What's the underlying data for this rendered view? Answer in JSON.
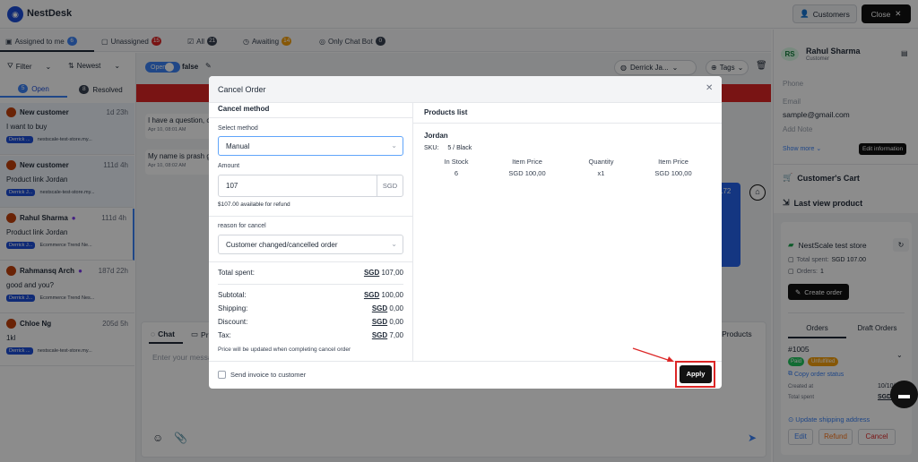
{
  "app": {
    "name": "NestDesk",
    "customers_btn": "Customers",
    "close_btn": "Close"
  },
  "tabs": [
    {
      "label": "Assigned to me",
      "count": "6",
      "color": "#3b82f6"
    },
    {
      "label": "Unassigned",
      "count": "15",
      "color": "#dc2626"
    },
    {
      "label": "All",
      "count": "21",
      "color": "#374151"
    },
    {
      "label": "Awaiting",
      "count": "14",
      "color": "#f59e0b"
    },
    {
      "label": "Only Chat Bot",
      "count": "0",
      "color": "#374151"
    }
  ],
  "filters": {
    "filter": "Filter",
    "sort": "Newest",
    "open_count": "5",
    "open_label": "Open",
    "resolved_count": "8",
    "resolved_label": "Resolved"
  },
  "conversations": [
    {
      "name": "New customer",
      "time": "1d 23h",
      "preview": "I want to buy",
      "agent": "Derrick ...",
      "store": "nestscale-test-store.my..."
    },
    {
      "name": "New customer",
      "time": "111d 4h",
      "preview": "Product link Jordan",
      "agent": "Derrick J...",
      "store": "nestscale-test-store.my..."
    },
    {
      "name": "Rahul Sharma",
      "time": "111d 4h",
      "preview": "Product link Jordan",
      "agent": "Derrick J...",
      "store": "Ecommerce Trend Ne..."
    },
    {
      "name": "Rahmansq Arch",
      "time": "187d 22h",
      "preview": "good and you?",
      "agent": "Derrick J...",
      "store": "Ecommerce Trend Nes..."
    },
    {
      "name": "Chloe Ng",
      "time": "205d 5h",
      "preview": "1kl",
      "agent": "Derrick ...",
      "store": "nestscale-test-store.my..."
    }
  ],
  "chat": {
    "open_label": "Open",
    "status_text": "false",
    "assignee": "Derrick Ja...",
    "tags": "Tags",
    "msg1": "I have a question, c",
    "msg1_time": "Apr 10, 08:01 AM",
    "msg2": "My name is prash g",
    "msg2_time": "Apr 10, 08:02 AM",
    "bubble_num": "172",
    "tab_chat": "Chat",
    "tab_pri": "Pri",
    "tab_products": "g Products",
    "input_placeholder": "Enter your messa"
  },
  "right": {
    "initials": "RS",
    "name": "Rahul Sharma",
    "role": "Customer",
    "phone_label": "Phone",
    "email_label": "Email",
    "email": "sample@gmail.com",
    "note": "Add Note",
    "show_more": "Show more",
    "edit_info": "Edit information",
    "cart": "Customer's Cart",
    "last_view": "Last view product",
    "store": "NestScale test store",
    "total_spent_label": "Total spent:",
    "total_spent": "SGD 107.00",
    "orders_label": "Orders:",
    "orders": "1",
    "create_order": "Create order",
    "orders_tab": "Orders",
    "draft_tab": "Draft Orders",
    "order_no": "#1005",
    "paid": "Paid",
    "unfulfilled": "Unfulfilled",
    "copy_status": "Copy order status",
    "created_label": "Created at",
    "created": "10/10/",
    "total_label": "Total spent",
    "total": "SGD 10",
    "update_address": "Update shipping address",
    "edit": "Edit",
    "refund": "Refund",
    "cancel": "Cancel"
  },
  "modal": {
    "title": "Cancel Order",
    "section": "Cancel method",
    "select_method_label": "Select method",
    "method": "Manual",
    "amount_label": "Amount",
    "amount": "107",
    "currency": "SGD",
    "available": "$107.00 available for refund",
    "reason_label": "reason for cancel",
    "reason": "Customer changed/cancelled order",
    "total_spent_label": "Total spent:",
    "total_spent_cur": "SGD",
    "total_spent_val": "107,00",
    "subtotal_label": "Subtotal:",
    "subtotal_cur": "SGD",
    "subtotal_val": "100,00",
    "shipping_label": "Shipping:",
    "shipping_cur": "SGD",
    "shipping_val": "0,00",
    "discount_label": "Discount:",
    "discount_cur": "SGD",
    "discount_val": "0,00",
    "tax_label": "Tax:",
    "tax_cur": "SGD",
    "tax_val": "7,00",
    "price_note": "Price will be updated when completing cancel order",
    "send_invoice": "Send invoice to customer",
    "products_title": "Products list",
    "product_name": "Jordan",
    "sku_label": "SKU:",
    "sku": "5 / Black",
    "headers": [
      "In Stock",
      "Item Price",
      "Quantity",
      "Item Price"
    ],
    "row": [
      "6",
      "SGD 100,00",
      "x1",
      "SGD 100,00"
    ],
    "apply": "Apply"
  }
}
